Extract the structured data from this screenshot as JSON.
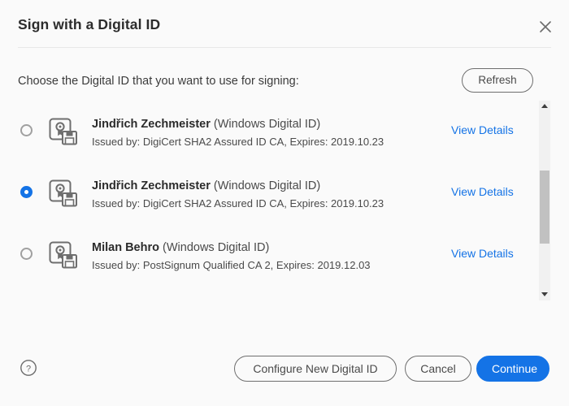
{
  "dialog": {
    "title": "Sign with a Digital ID",
    "close_icon": "close-icon"
  },
  "prompt": {
    "label": "Choose the Digital ID that you want to use for signing:",
    "refresh_label": "Refresh"
  },
  "list": {
    "items": [
      {
        "selected": false,
        "name": "Jindřich Zechmeister",
        "type": " (Windows Digital ID)",
        "issued_by": "Issued by: DigiCert SHA2 Assured ID CA, Expires: 2019.10.23",
        "details_label": "View Details"
      },
      {
        "selected": true,
        "name": "Jindřich Zechmeister",
        "type": " (Windows Digital ID)",
        "issued_by": "Issued by: DigiCert SHA2 Assured ID CA, Expires: 2019.10.23",
        "details_label": "View Details"
      },
      {
        "selected": false,
        "name": "Milan Behro",
        "type": " (Windows Digital ID)",
        "issued_by": "Issued by: PostSignum Qualified CA 2, Expires: 2019.12.03",
        "details_label": "View Details"
      }
    ]
  },
  "scrollbar": {
    "up_icon": "chevron-up-icon",
    "down_icon": "chevron-down-icon",
    "thumb": "scrollbar-thumb"
  },
  "footer": {
    "help_icon": "help-circle-icon",
    "configure_label": "Configure New Digital ID",
    "cancel_label": "Cancel",
    "continue_label": "Continue"
  },
  "colors": {
    "accent": "#1473e6",
    "link": "#1473e6",
    "background": "#fafafa",
    "border": "#6e6e6e",
    "scrollbar_thumb": "#c1c1c1"
  }
}
